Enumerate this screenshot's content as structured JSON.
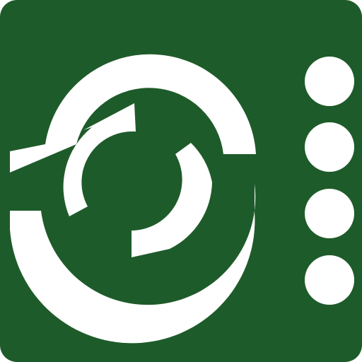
{
  "icon": {
    "kind": "app-launcher-icon",
    "symbol": "circular-sync-emblem",
    "indicator_dots": 4,
    "colors": {
      "background": "#1E5B2A",
      "foreground": "#FFFFFF"
    }
  }
}
